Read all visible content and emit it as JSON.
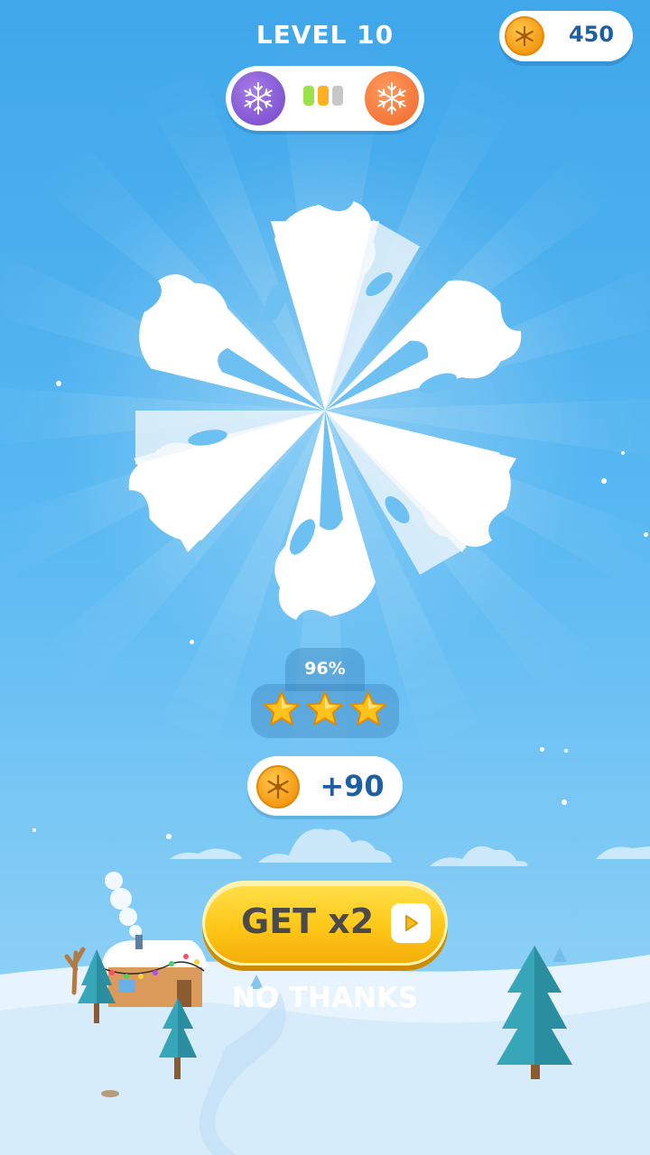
{
  "header": {
    "level_title": "LEVEL 10"
  },
  "wallet": {
    "coins": "450",
    "icon": "snowflake-coin-icon"
  },
  "progress": {
    "left_stage_icon": "snowflake-icon",
    "right_stage_icon": "snowflake-icon",
    "segments": [
      "filled-green",
      "filled-orange",
      "empty"
    ],
    "colors": {
      "left": "#8b5cd6",
      "right": "#f4763a",
      "seg_green": "#9be24a",
      "seg_orange": "#ffb020",
      "seg_empty": "#c7c7c7"
    }
  },
  "result": {
    "match_percent": "96%",
    "stars_earned": 3,
    "stars_total": 3,
    "reward": "+90"
  },
  "actions": {
    "double_label": "GET x2",
    "double_icon": "play-icon",
    "skip_label": "NO THANKS"
  },
  "colors": {
    "sky_top": "#3fa7ea",
    "sky_bottom": "#9fd8f8",
    "button": "#ffc718",
    "text_blue": "#1e5fa3"
  }
}
